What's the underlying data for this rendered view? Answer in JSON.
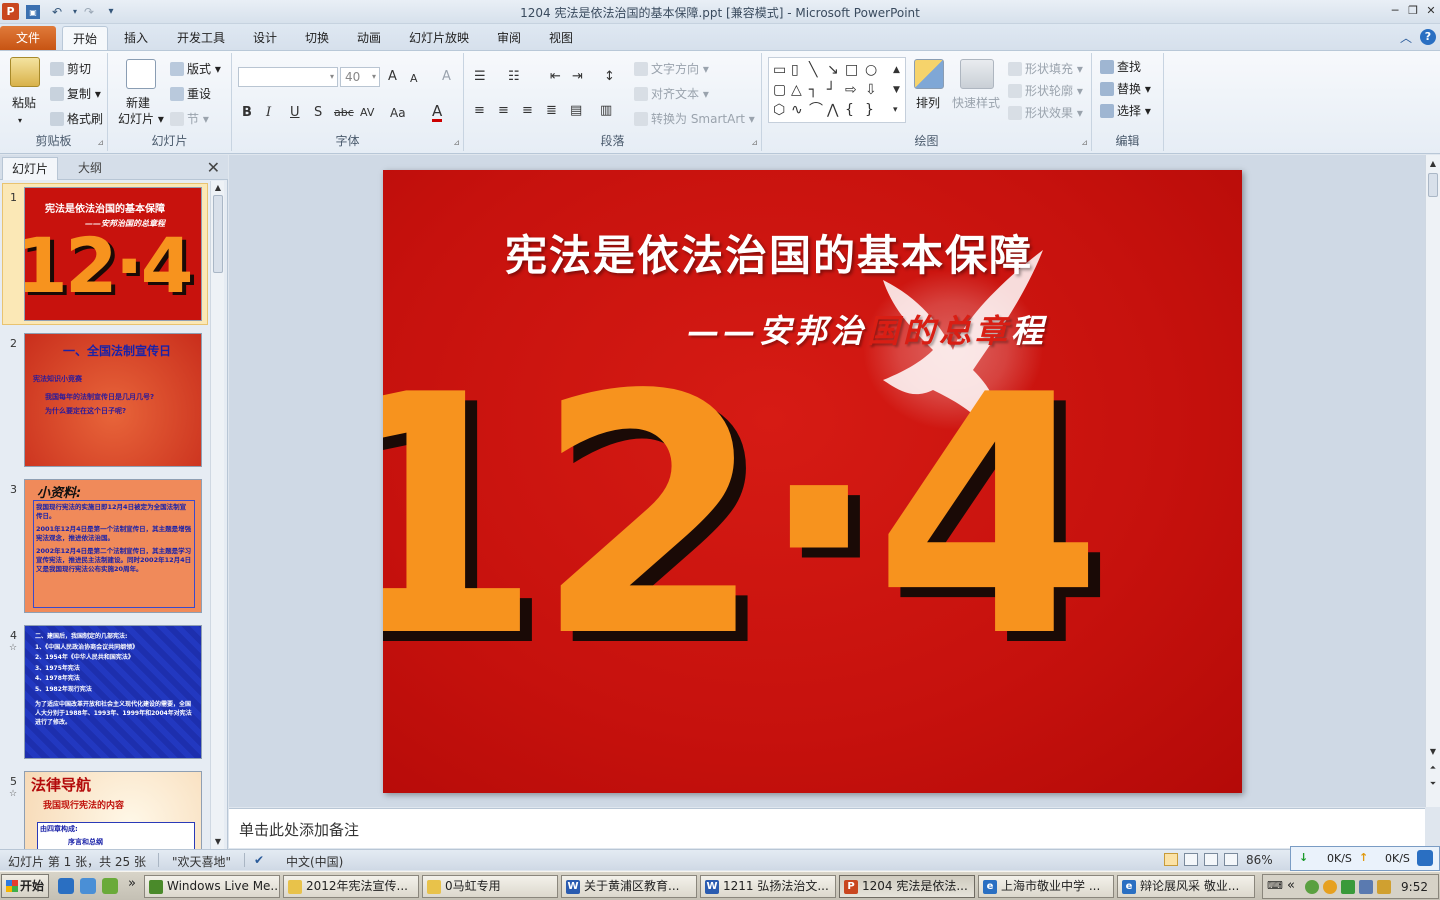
{
  "window": {
    "title": "1204 宪法是依法治国的基本保障.ppt [兼容模式]  -  Microsoft PowerPoint",
    "app_logo": "P",
    "qat_undo": "↶",
    "qat_redo": "↷",
    "qat_customize": "▾",
    "minimize": "─",
    "restore": "❐",
    "close": "✕"
  },
  "ribbon_tabs": {
    "file": "文件",
    "home": "开始",
    "insert": "插入",
    "developer": "开发工具",
    "design": "设计",
    "transitions": "切换",
    "animations": "动画",
    "slideshow": "幻灯片放映",
    "review": "审阅",
    "view": "视图",
    "collapse": "︿",
    "help": "?"
  },
  "ribbon": {
    "clipboard": {
      "label": "剪贴板",
      "paste": "粘贴",
      "cut": "剪切",
      "copy": "复制",
      "format_painter": "格式刷"
    },
    "slides": {
      "label": "幻灯片",
      "new_slide_line1": "新建",
      "new_slide_line2": "幻灯片 ▾",
      "layout": "版式 ▾",
      "reset": "重设",
      "section": "节 ▾"
    },
    "font": {
      "label": "字体",
      "font_name": "",
      "font_size": "40",
      "grow": "A",
      "shrink": "A",
      "clear": "A",
      "bold": "B",
      "italic": "I",
      "underline": "U",
      "shadow": "S",
      "strike": "abc",
      "spacing": "AV",
      "case": "Aa",
      "color": "A"
    },
    "paragraph": {
      "label": "段落",
      "text_direction": "文字方向 ▾",
      "align_text": "对齐文本 ▾",
      "smartart": "转换为 SmartArt ▾"
    },
    "drawing": {
      "label": "绘图",
      "arrange": "排列",
      "quick_styles": "快速样式",
      "fill": "形状填充 ▾",
      "outline": "形状轮廓 ▾",
      "effects": "形状效果 ▾"
    },
    "editing": {
      "label": "编辑",
      "find": "查找",
      "replace": "替换 ▾",
      "select": "选择 ▾"
    }
  },
  "left_panel": {
    "tab_slides": "幻灯片",
    "tab_outline": "大纲",
    "close": "✕",
    "thumbnails": [
      {
        "num": "1",
        "title": "宪法是依法治国的基本保障",
        "subtitle": "——安邦治国的总章程",
        "big": "12·4"
      },
      {
        "num": "2",
        "title": "一、全国法制宣传日",
        "line1": "宪法知识小竞赛",
        "line2": "我国每年的法制宣传日是几月几号?",
        "line3": "为什么要定在这个日子呢?"
      },
      {
        "num": "3",
        "title": "小资料:",
        "line1": "我国现行宪法的实施日即12月4日被定为全国法制宣传日。",
        "line2": "2001年12月4日是第一个法制宣传日，其主题是增强宪法观念，推进依法治国。",
        "line3": "2002年12月4日是第二个法制宣传日，其主题是学习宣传宪法，推进民主法制建设。同时2002年12月4日又是我国现行宪法公布实施20周年。"
      },
      {
        "num": "4",
        "title": "二、建国后，我国制定的几部宪法:",
        "line1": "1、《中国人民政治协商会议共同纲领》",
        "line2": "2、1954年《中华人民共和国宪法》",
        "line3": "3、1975年宪法",
        "line4": "4、1978年宪法",
        "line5": "5、1982年现行宪法",
        "line6": "为了适应中国改革开放和社会主义现代化建设的需要，全国人大分别于1988年、1993年、1999年和2004年对宪法进行了修改。"
      },
      {
        "num": "5",
        "title": "法律导航",
        "line1": "我国现行宪法的内容",
        "line2": "由四章构成:",
        "line3": "序言和总纲"
      }
    ]
  },
  "slide": {
    "title": "宪法是依法治国的基本保障",
    "subtitle_dash": "——",
    "subtitle_white1": "安邦治",
    "subtitle_red": "国的总章",
    "subtitle_white2": "程",
    "date_big": "12·4",
    "colors": {
      "background": "#c6110d",
      "date": "#f7931e",
      "title": "#ffffff"
    }
  },
  "notes": {
    "placeholder": "单击此处添加备注"
  },
  "statusbar": {
    "slide_info": "幻灯片 第 1 张，共 25 张",
    "theme": "\"欢天喜地\"",
    "language": "中文(中国)",
    "zoom": "86%",
    "net_down": "0K/S",
    "net_up": "0K/S"
  },
  "taskbar": {
    "start": "开始",
    "tasks": [
      "Windows Live Me...",
      "2012年宪法宣传...",
      "0马虹专用",
      "关于黄浦区教育...",
      "1211 弘扬法治文...",
      "1204 宪法是依法...",
      "上海市敬业中学 ...",
      "辩论展风采 敬业..."
    ],
    "more": "»",
    "tray_more": "«",
    "clock": "9:52"
  }
}
